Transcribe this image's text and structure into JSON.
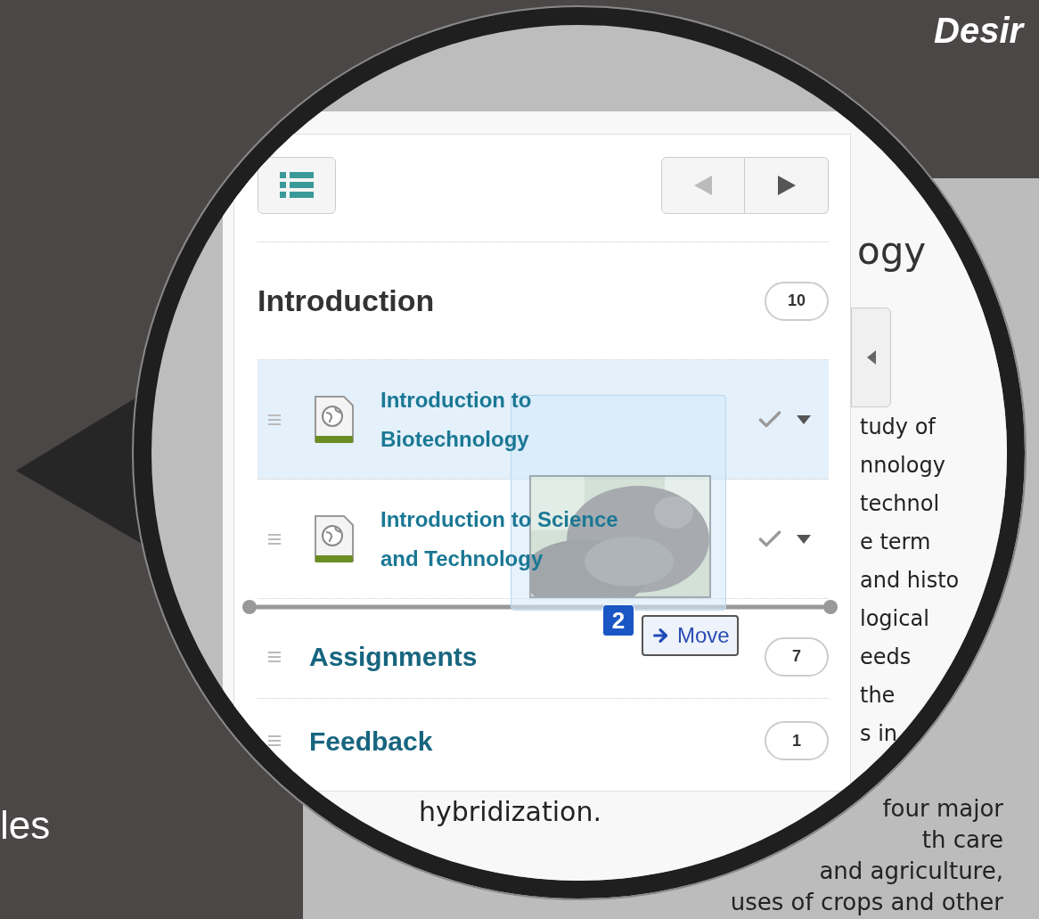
{
  "brand": "Desir",
  "caption": "les",
  "panel": {
    "section": {
      "title": "Introduction",
      "count": "10"
    },
    "items": [
      {
        "title": "Introduction to Biotechnology",
        "selected": true
      },
      {
        "title": "Introduction to Science and Technology",
        "selected": false
      }
    ],
    "sections": [
      {
        "title": "Assignments",
        "count": "7"
      },
      {
        "title": "Feedback",
        "count": "1"
      }
    ],
    "drag": {
      "count": "2",
      "action": "Move"
    }
  },
  "page": {
    "heading": "ogy",
    "lines": [
      "tudy of",
      "nnology",
      "technol",
      "e term",
      "and histo",
      "logical",
      "eeds",
      "the",
      "s in"
    ],
    "last_line": "hybridization.",
    "outside_lines": [
      "four major",
      "th care",
      "and agriculture,",
      "uses of crops and other"
    ]
  }
}
